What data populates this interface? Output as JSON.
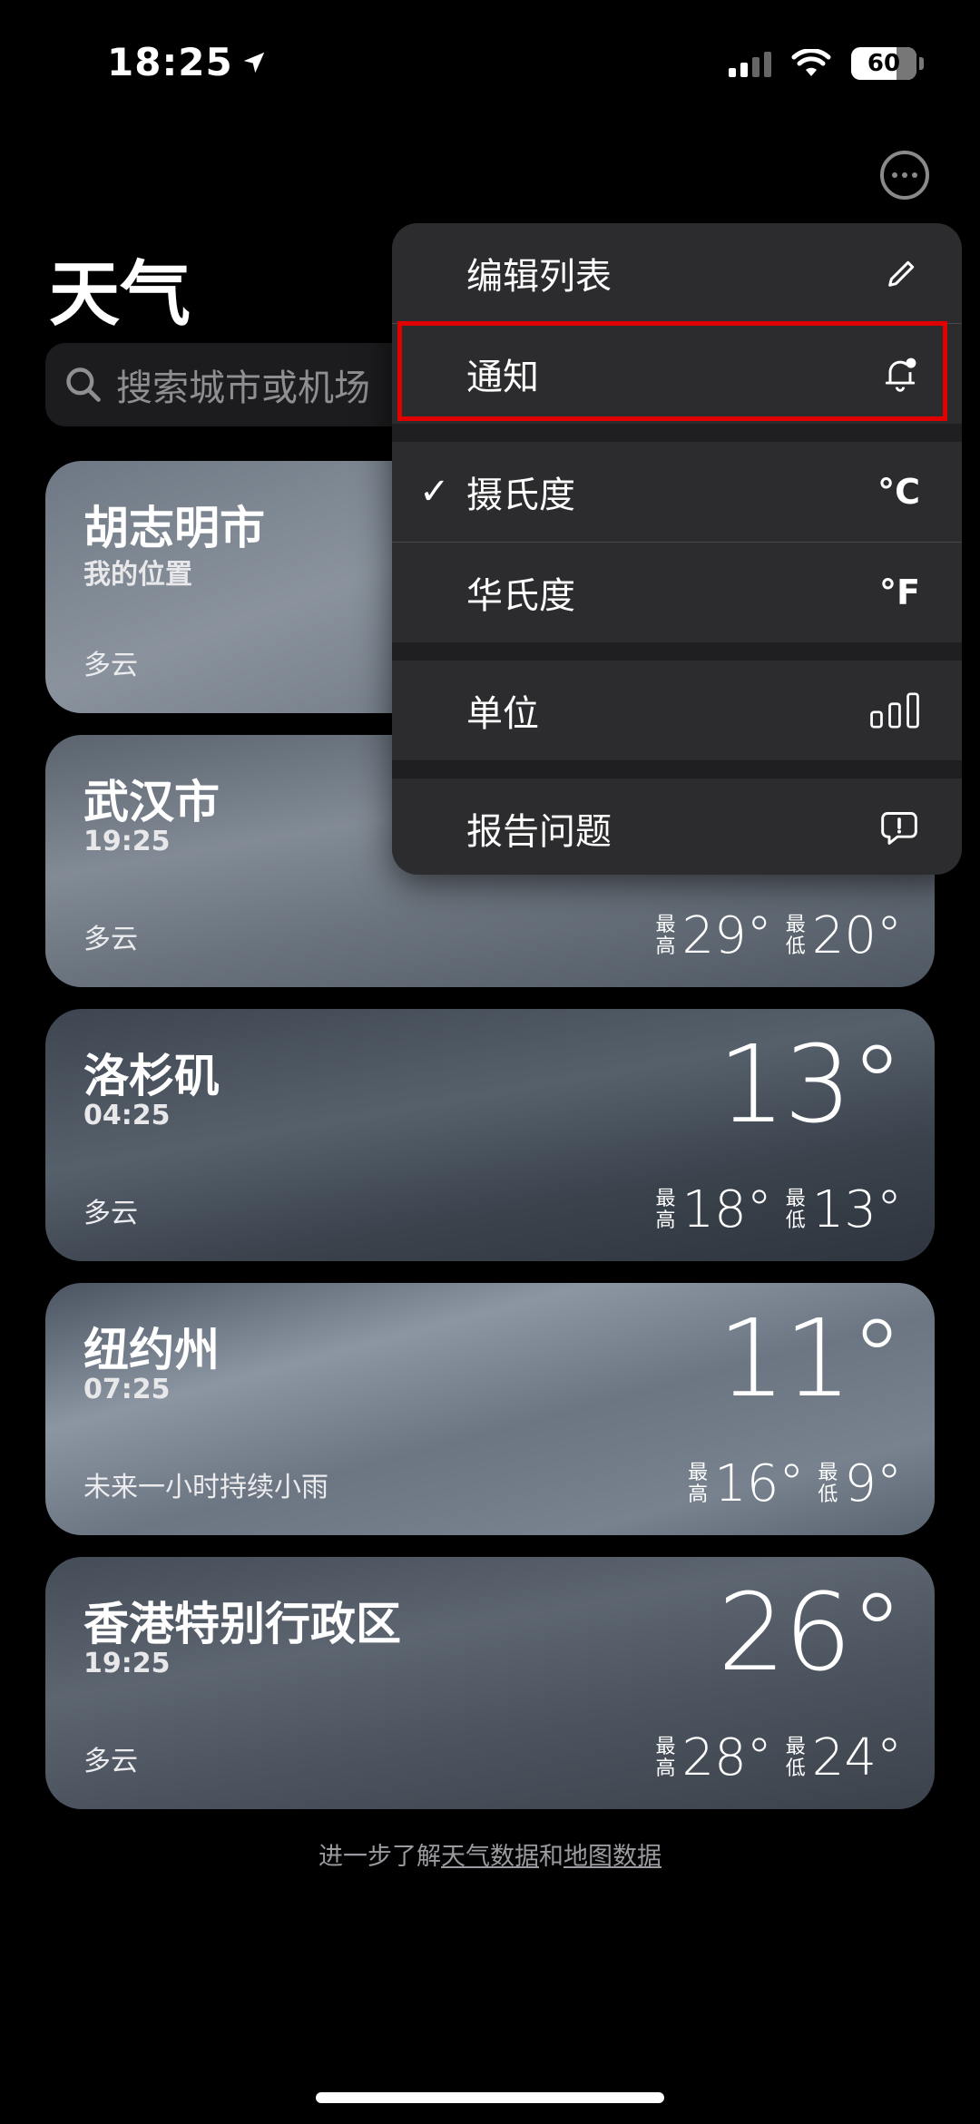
{
  "status_bar": {
    "time": "18:25",
    "battery": "60",
    "icons": [
      "location-arrow-icon",
      "cellular-signal-icon",
      "wifi-icon",
      "battery-icon"
    ]
  },
  "header": {
    "title": "天气",
    "more_icon": "ellipsis-circle-icon"
  },
  "search": {
    "placeholder": "搜索城市或机场",
    "icon": "search-icon"
  },
  "cities": [
    {
      "name": "胡志明市",
      "subtitle": "我的位置",
      "condition": "多云",
      "temp": "",
      "high_label": "",
      "high": "",
      "low_label": "",
      "low": ""
    },
    {
      "name": "武汉市",
      "subtitle": "19:25",
      "condition": "多云",
      "temp": "",
      "high_label": "最高",
      "high": "29°",
      "low_label": "最低",
      "low": "20°"
    },
    {
      "name": "洛杉矶",
      "subtitle": "04:25",
      "condition": "多云",
      "temp": "13°",
      "high_label": "最高",
      "high": "18°",
      "low_label": "最低",
      "low": "13°"
    },
    {
      "name": "纽约州",
      "subtitle": "07:25",
      "condition": "未来一小时持续小雨",
      "temp": "11°",
      "high_label": "最高",
      "high": "16°",
      "low_label": "最低",
      "low": "9°"
    },
    {
      "name": "香港特别行政区",
      "subtitle": "19:25",
      "condition": "多云",
      "temp": "26°",
      "high_label": "最高",
      "high": "28°",
      "low_label": "最低",
      "low": "24°"
    }
  ],
  "footer": {
    "prefix": "进一步了解",
    "link1": "天气数据",
    "middle": "和",
    "link2": "地图数据"
  },
  "menu": {
    "items": [
      {
        "label": "编辑列表",
        "trail_icon": "pencil-icon"
      },
      {
        "label": "通知",
        "trail_icon": "bell-badge-icon"
      },
      {
        "label": "摄氏度",
        "trail_text": "°C",
        "checked": true
      },
      {
        "label": "华氏度",
        "trail_text": "°F"
      },
      {
        "label": "单位",
        "trail_icon": "bar-chart-icon"
      },
      {
        "label": "报告问题",
        "trail_icon": "exclamation-bubble-icon"
      }
    ]
  },
  "colors": {
    "background": "#000000",
    "menu_bg": "#2c2c2e",
    "highlight": "#e00000",
    "search_bg": "#1c1c1e"
  }
}
